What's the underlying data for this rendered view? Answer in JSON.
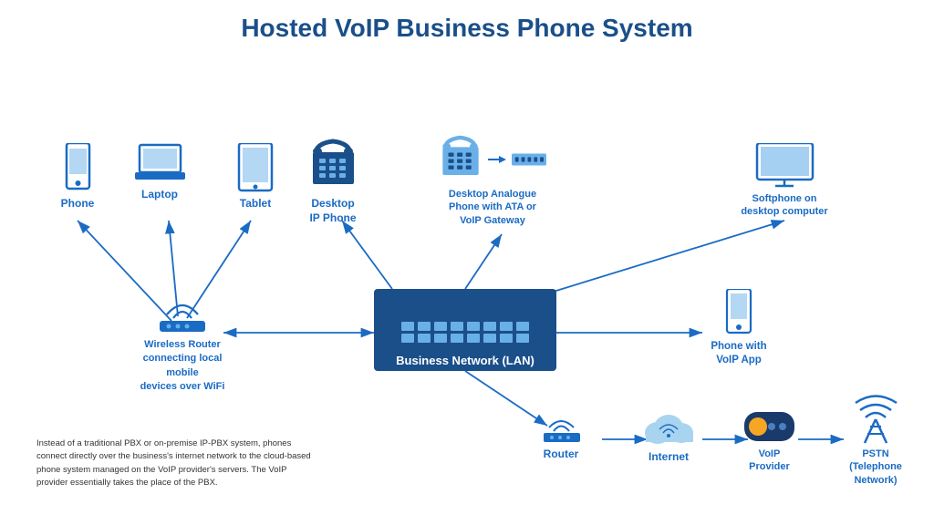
{
  "title": "Hosted VoIP Business Phone System",
  "devices": {
    "phone": {
      "label": "Phone"
    },
    "laptop": {
      "label": "Laptop"
    },
    "tablet": {
      "label": "Tablet"
    },
    "desktop_ip_phone": {
      "label": "Desktop\nIP Phone"
    },
    "desktop_analogue": {
      "label": "Desktop Analogue\nPhone with ATA or\nVoIP Gateway"
    },
    "softphone": {
      "label": "Softphone on\ndesktop computer"
    },
    "wireless_router": {
      "label": "Wireless Router\nconnecting local mobile\ndevices over WiFi"
    },
    "phone_voip": {
      "label": "Phone with\nVoIP App"
    },
    "router": {
      "label": "Router"
    },
    "internet": {
      "label": "Internet"
    },
    "voip_provider": {
      "label": "VoIP\nProvider"
    },
    "pstn": {
      "label": "PSTN\n(Telephone\nNetwork)"
    },
    "business_network": {
      "label": "Business Network (LAN)"
    }
  },
  "bottom_text": "Instead of a traditional PBX or on-premise IP-PBX system, phones connect directly over the business's internet network to the cloud-based phone system managed on the VoIP provider's servers. The VoIP provider essentially takes the place of the PBX."
}
